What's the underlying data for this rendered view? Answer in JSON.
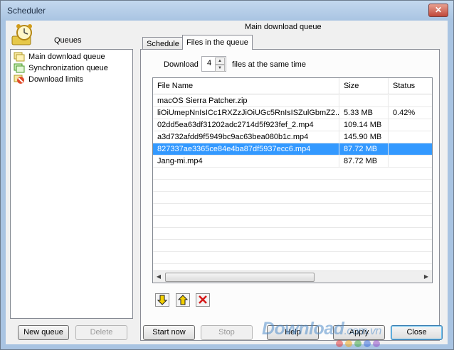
{
  "window": {
    "title": "Scheduler",
    "close_glyph": "✕"
  },
  "queues": {
    "label": "Queues",
    "items": [
      {
        "label": "Main download queue",
        "icon": "queue-folder-icon"
      },
      {
        "label": "Synchronization queue",
        "icon": "sync-queue-icon"
      },
      {
        "label": "Download limits",
        "icon": "download-limits-icon"
      }
    ]
  },
  "main": {
    "title": "Main download queue",
    "tabs": [
      {
        "label": "Schedule"
      },
      {
        "label": "Files in the queue"
      }
    ],
    "download": {
      "prefix": "Download",
      "value": "4",
      "suffix": "files at the same time"
    },
    "grid": {
      "columns": [
        "File Name",
        "Size",
        "Status"
      ],
      "rows": [
        {
          "name": "macOS Sierra Patcher.zip",
          "size": "",
          "status": ""
        },
        {
          "name": "liOiUmepNnIsICc1RXZzJiOiUGc5RnIsISZulGbmZ2...",
          "size": "5.33  MB",
          "status": "0.42%"
        },
        {
          "name": "02dd5ea63df31202adc2714d5f923fef_2.mp4",
          "size": "109.14  MB",
          "status": ""
        },
        {
          "name": "a3d732afdd9f5949bc9ac63bea080b1c.mp4",
          "size": "145.90  MB",
          "status": ""
        },
        {
          "name": "827337ae3365ce84e4ba87df5937ecc6.mp4",
          "size": "87.72  MB",
          "status": ""
        },
        {
          "name": "Jang-mi.mp4",
          "size": "87.72  MB",
          "status": ""
        }
      ]
    }
  },
  "buttons": {
    "new_queue": "New queue",
    "delete": "Delete",
    "start_now": "Start now",
    "stop": "Stop",
    "help": "Help",
    "apply": "Apply",
    "close": "Close"
  },
  "watermark": {
    "text": "Download",
    "suffix": ".com.vn"
  },
  "colors": {
    "selection": "#3399ff",
    "titlebar": "#a9c4e2",
    "window_bg": "#f0f0f0"
  }
}
